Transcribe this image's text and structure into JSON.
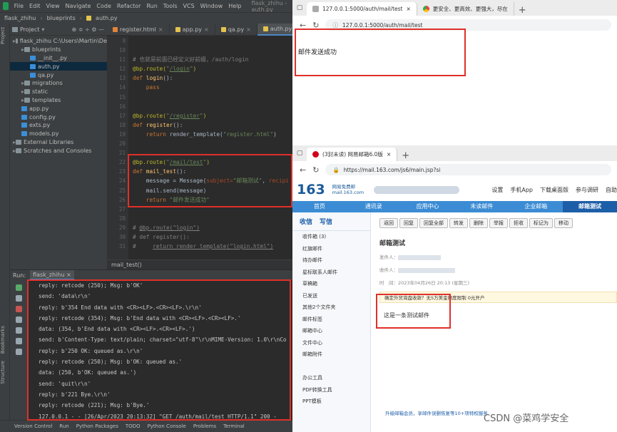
{
  "ide": {
    "menu": [
      "File",
      "Edit",
      "View",
      "Navigate",
      "Code",
      "Refactor",
      "Run",
      "Tools",
      "VCS",
      "Window",
      "Help"
    ],
    "window_title": "flask_zhihu - auth.py",
    "nav": [
      "flask_zhihu",
      "blueprints",
      "auth.py"
    ],
    "project_label": "Project",
    "tree": [
      {
        "label": "flask_zhihu  C:\\Users\\Martin\\De",
        "type": "folder",
        "indent": 0
      },
      {
        "label": "blueprints",
        "type": "folder",
        "indent": 1
      },
      {
        "label": "__init__.py",
        "type": "py",
        "indent": 2
      },
      {
        "label": "auth.py",
        "type": "py",
        "indent": 2,
        "selected": true
      },
      {
        "label": "qa.py",
        "type": "py",
        "indent": 2
      },
      {
        "label": "migrations",
        "type": "folder",
        "indent": 1
      },
      {
        "label": "static",
        "type": "folder",
        "indent": 1
      },
      {
        "label": "templates",
        "type": "folder",
        "indent": 1
      },
      {
        "label": "app.py",
        "type": "py",
        "indent": 1
      },
      {
        "label": "config.py",
        "type": "py",
        "indent": 1
      },
      {
        "label": "exts.py",
        "type": "py",
        "indent": 1
      },
      {
        "label": "models.py",
        "type": "py",
        "indent": 1
      },
      {
        "label": "External Libraries",
        "type": "folder",
        "indent": 0
      },
      {
        "label": "Scratches and Consoles",
        "type": "folder",
        "indent": 0
      }
    ],
    "tabs": [
      "register.html",
      "app.py",
      "qa.py",
      "auth.py",
      "co"
    ],
    "active_tab": "auth.py",
    "line_numbers": [
      "9",
      "10",
      "11",
      "12",
      "13",
      "14",
      "15",
      "16",
      "17",
      "18",
      "19",
      "20",
      "21",
      "22",
      "23",
      "24",
      "25",
      "26",
      "27",
      "28",
      "29",
      "30",
      "31"
    ],
    "breadcrumb": "mail_test()",
    "run_label": "Run:",
    "run_config": "flask_zhihu",
    "console": [
      "reply: retcode (250); Msg: b'OK'",
      "send: 'data\\r\\n'",
      "reply: b'354 End data with <CR><LF>.<CR><LF>.\\r\\n'",
      "reply: retcode (354); Msg: b'End data with <CR><LF>.<CR><LF>.'",
      "data: (354, b'End data with <CR><LF>.<CR><LF>.')",
      "send: b'Content-Type: text/plain; charset=\"utf-8\"\\r\\nMIME-Version: 1.0\\r\\nCo",
      "reply: b'250 OK: queued as.\\r\\n'",
      "reply: retcode (250); Msg: b'OK: queued as.'",
      "data: (250, b'OK: queued as.')",
      "send: 'quit\\r\\n'",
      "reply: b'221 Bye.\\r\\n'",
      "reply: retcode (221); Msg: b'Bye.'",
      "127.0.0.1 - - [26/Apr/2023 20:13:32] \"GET /auth/mail/test HTTP/1.1\" 200 -"
    ],
    "status_items": [
      "Version Control",
      "Run",
      "Python Packages",
      "TODO",
      "Python Console",
      "Problems",
      "Terminal"
    ],
    "side_labels": [
      "Project",
      "Bookmarks",
      "Structure"
    ]
  },
  "browser1": {
    "tab1": "127.0.0.1:5000/auth/mail/test",
    "tab2": "更安全、更高效、更强大，尽在",
    "url": "127.0.0.1:5000/auth/mail/test",
    "content": "邮件发送成功"
  },
  "browser2": {
    "tab1": "(3封未读) 网易邮箱6.0版",
    "url": "https://mail.163.com/js6/main.jsp?si",
    "logo": "163",
    "logo_sub": "网易免费邮 mail.163.com",
    "header_links": [
      "设置",
      "手机App",
      "下载桌面版",
      "参与调研",
      "自助"
    ],
    "nav": [
      "首页",
      "通讯录",
      "应用中心",
      "未读邮件",
      "企业邮箱",
      "邮箱测试"
    ],
    "active_nav": "邮箱测试",
    "side_buttons": [
      "收信",
      "写信"
    ],
    "folders": [
      "收件箱 (3)",
      "红旗邮件",
      "待办邮件",
      "星标联系人邮件",
      "草稿箱",
      "已发送",
      "其他2个文件夹",
      "邮件标签",
      "邮箱中心",
      "文件中心",
      "邮箱附件",
      "",
      "办公工具",
      "PDF转换工具",
      "PPT模板"
    ],
    "toolbar": [
      "返回",
      "回复",
      "回复全部",
      "转发",
      "删除",
      "举报",
      "拒收",
      "标记为",
      "移动"
    ],
    "subject": "邮箱测试",
    "from_label": "发件人：",
    "to_label": "收件人：",
    "time": "时　间：2023年04月26日 20:13 (星期三)",
    "warning": "确定外贸询盘收款？无5万美金额度限制  0元开户",
    "body": "这是一条测试邮件",
    "footer": "升级邮箱会员，享邮件误删恢复等10+项特权服务",
    "watermark": "CSDN @菜鸡学安全"
  }
}
